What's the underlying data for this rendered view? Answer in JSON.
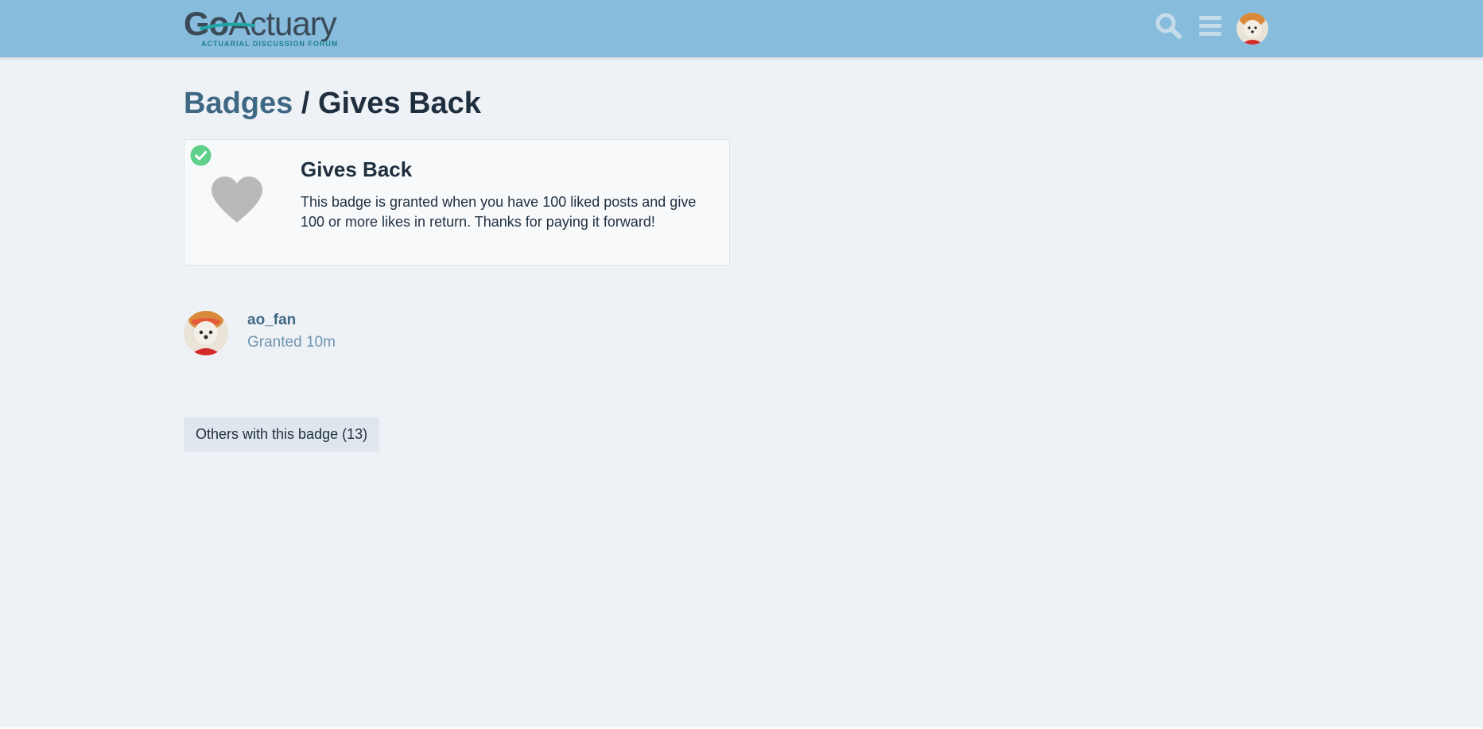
{
  "header": {
    "logo_text_bold": "Go",
    "logo_text_regular": "Actuary",
    "logo_tagline": "ACTUARIAL DISCUSSION FORUM",
    "icons": [
      "search-icon",
      "hamburger-menu-icon",
      "user-avatar"
    ],
    "background_color": "#87bcdc"
  },
  "page": {
    "breadcrumb_parent": "Badges",
    "breadcrumb_separator": "/",
    "breadcrumb_current": "Gives Back"
  },
  "badge": {
    "name": "Gives Back",
    "description": "This badge is granted when you have 100 liked posts and give 100 or more likes in return. Thanks for paying it forward!",
    "icon": "heart-icon",
    "granted_indicator": "check-icon",
    "check_color": "#5fd18b",
    "heart_color": "#b9b9b9"
  },
  "grant": {
    "username": "ao_fan",
    "granted_label": "Granted",
    "granted_time": "10m"
  },
  "others_button": {
    "label": "Others with this badge (13)"
  },
  "colors": {
    "link": "#3e6883",
    "muted": "#6f94b0",
    "page_bg": "#eef2f6"
  }
}
